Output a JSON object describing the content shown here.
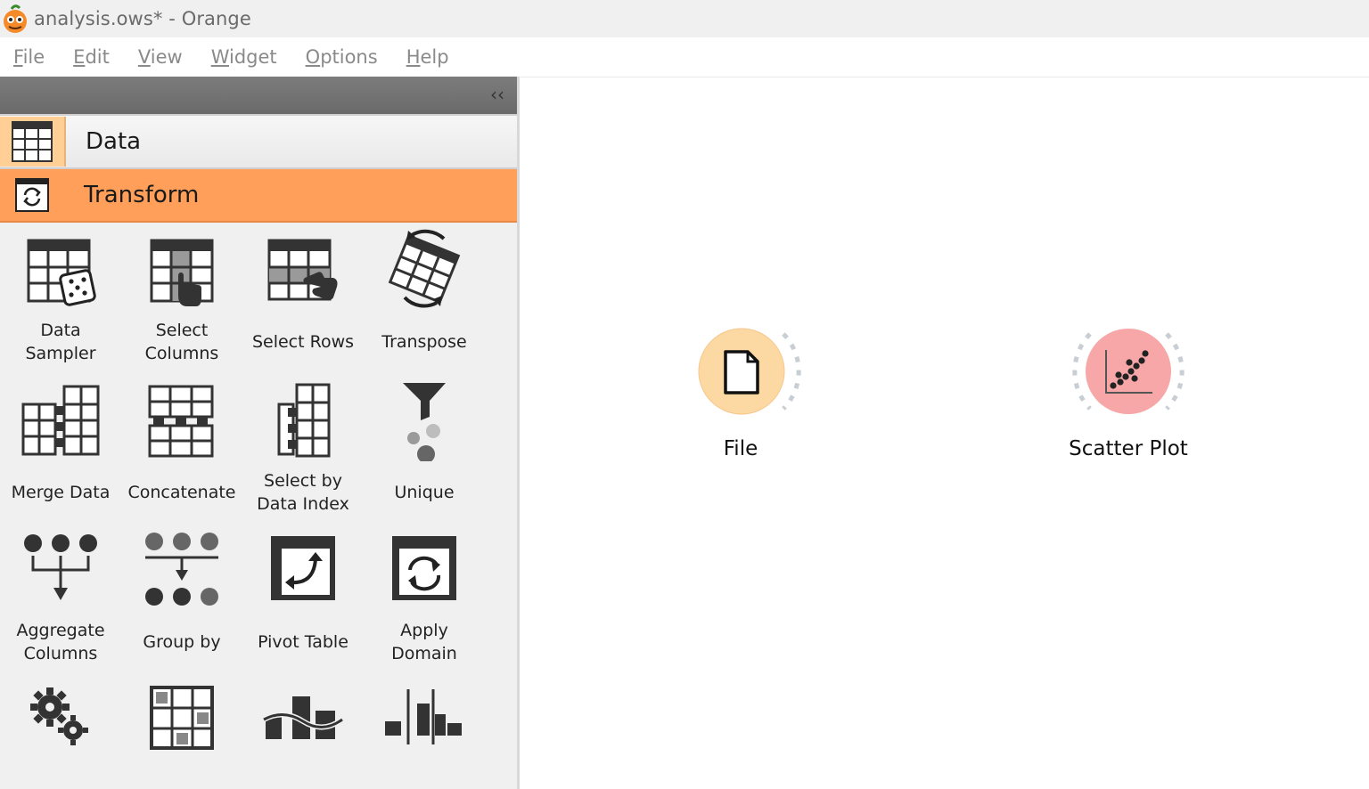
{
  "window": {
    "title": "analysis.ows* - Orange"
  },
  "menu": [
    {
      "mnemonic": "F",
      "rest": "ile"
    },
    {
      "mnemonic": "E",
      "rest": "dit"
    },
    {
      "mnemonic": "V",
      "rest": "iew"
    },
    {
      "mnemonic": "W",
      "rest": "idget"
    },
    {
      "mnemonic": "O",
      "rest": "ptions"
    },
    {
      "mnemonic": "H",
      "rest": "elp"
    }
  ],
  "dock": {
    "collapse_glyph": "‹‹",
    "categories": [
      {
        "label": "Data",
        "icon": "table-icon"
      },
      {
        "label": "Transform",
        "icon": "transform-icon"
      }
    ],
    "widgets": [
      {
        "label": "Data\nSampler",
        "icon": "data-sampler-icon"
      },
      {
        "label": "Select\nColumns",
        "icon": "select-columns-icon"
      },
      {
        "label": "Select Rows",
        "icon": "select-rows-icon"
      },
      {
        "label": "Transpose",
        "icon": "transpose-icon"
      },
      {
        "label": "Merge Data",
        "icon": "merge-data-icon"
      },
      {
        "label": "Concatenate",
        "icon": "concatenate-icon"
      },
      {
        "label": "Select by\nData Index",
        "icon": "select-by-index-icon"
      },
      {
        "label": "Unique",
        "icon": "unique-icon"
      },
      {
        "label": "Aggregate\nColumns",
        "icon": "aggregate-columns-icon"
      },
      {
        "label": "Group by",
        "icon": "group-by-icon"
      },
      {
        "label": "Pivot Table",
        "icon": "pivot-table-icon"
      },
      {
        "label": "Apply\nDomain",
        "icon": "apply-domain-icon"
      },
      {
        "label": "",
        "icon": "preprocess-icon"
      },
      {
        "label": "",
        "icon": "impute-icon"
      },
      {
        "label": "",
        "icon": "continuize-icon"
      },
      {
        "label": "",
        "icon": "discretize-icon"
      }
    ]
  },
  "canvas": {
    "nodes": [
      {
        "label": "File",
        "icon": "file-icon",
        "color": "#fcd9a3"
      },
      {
        "label": "Scatter Plot",
        "icon": "scatter-plot-icon",
        "color": "#f7a7a7"
      }
    ]
  },
  "colors": {
    "transform_accent": "#ff9f5a",
    "data_accent": "#ffcf95"
  }
}
